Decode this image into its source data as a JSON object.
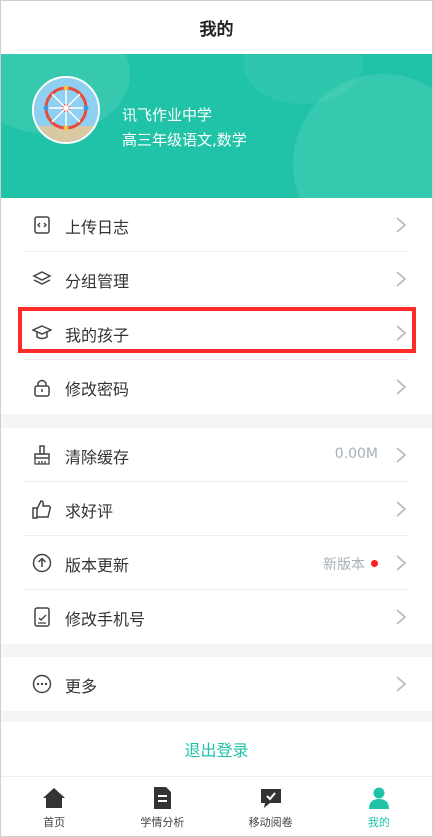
{
  "topbar": {
    "title": "我的"
  },
  "profile": {
    "school": "讯飞作业中学",
    "subjects": "高三年级语文,数学"
  },
  "groups": [
    {
      "items": [
        {
          "label": "上传日志",
          "icon": "upload-log-icon"
        },
        {
          "label": "分组管理",
          "icon": "layers-icon"
        },
        {
          "label": "我的孩子",
          "icon": "graduation-cap-icon"
        },
        {
          "label": "修改密码",
          "icon": "lock-icon"
        }
      ]
    },
    {
      "items": [
        {
          "label": "清除缓存",
          "icon": "broom-icon",
          "value": "0.00M"
        },
        {
          "label": "求好评",
          "icon": "thumbs-up-icon"
        },
        {
          "label": "版本更新",
          "icon": "arrow-up-circle-icon",
          "value": "新版本"
        },
        {
          "label": "修改手机号",
          "icon": "phone-edit-icon"
        }
      ]
    },
    {
      "items": [
        {
          "label": "更多",
          "icon": "more-circle-icon"
        }
      ]
    }
  ],
  "logout": {
    "label": "退出登录"
  },
  "tabs": [
    {
      "label": "首页",
      "icon": "home-icon"
    },
    {
      "label": "学情分析",
      "icon": "document-icon"
    },
    {
      "label": "移动阅卷",
      "icon": "chat-marking-icon"
    },
    {
      "label": "我的",
      "icon": "person-icon",
      "active": true
    }
  ],
  "colors": {
    "accent": "#21c3a8",
    "highlight": "#ff2b2b",
    "badge": "#ff1f1f"
  }
}
